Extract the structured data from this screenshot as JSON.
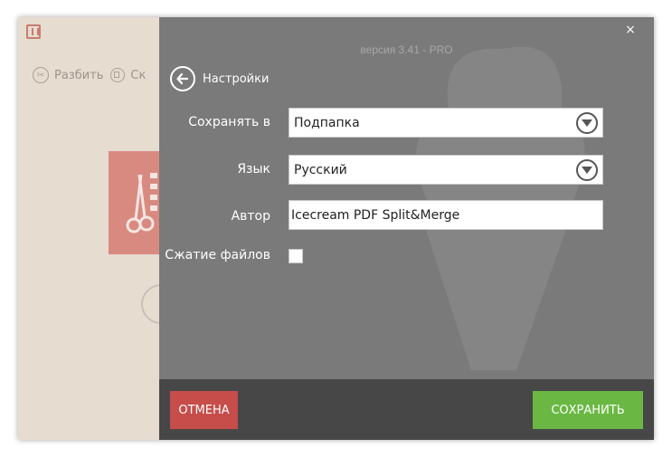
{
  "toolbar": {
    "split_label": "Разбить",
    "merge_label": "Ск"
  },
  "settings": {
    "version": "версия 3.41 - PRO",
    "close_symbol": "×",
    "back_label": "Настройки",
    "save_to_label": "Сохранять в",
    "save_to_value": "Подпапка",
    "language_label": "Язык",
    "language_value": "Русский",
    "author_label": "Автор",
    "author_value": "Icecream PDF Split&Merge",
    "compression_label": "Сжатие файлов",
    "compression_checked": false
  },
  "footer": {
    "cancel_label": "ОТМЕНА",
    "save_label": "СОХРАНИТЬ"
  },
  "colors": {
    "overlay": "#7a7a7a",
    "footer": "#474747",
    "cancel": "#c64d4a",
    "save": "#6ab843",
    "background_panel": "#e6dcd0",
    "tile": "#d98a80"
  }
}
